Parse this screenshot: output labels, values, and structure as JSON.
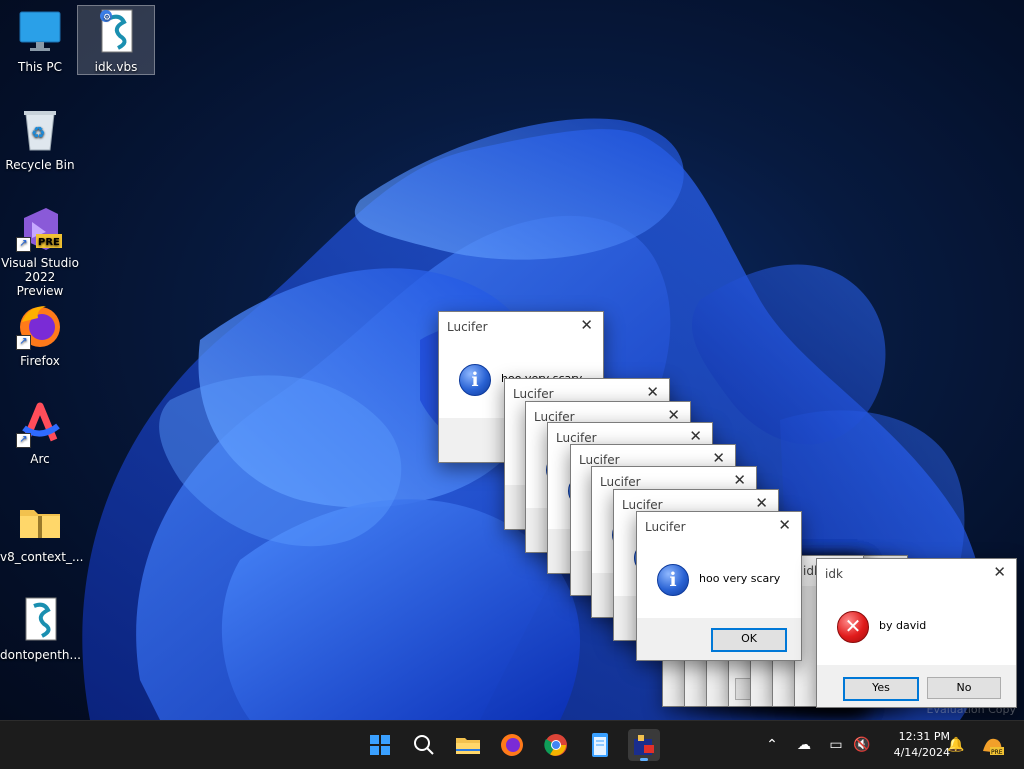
{
  "desktop_icons": [
    {
      "label": "This PC",
      "icon": "monitor-icon"
    },
    {
      "label": "idk.vbs",
      "icon": "script-file-icon"
    },
    {
      "label": "Recycle Bin",
      "icon": "recycle-bin-icon"
    },
    {
      "label": "Visual Studio 2022 Preview",
      "icon": "visual-studio-icon",
      "badge": "PRE"
    },
    {
      "label": "Firefox",
      "icon": "firefox-icon"
    },
    {
      "label": "Arc",
      "icon": "arc-icon"
    },
    {
      "label": "v8_context_...",
      "icon": "zip-folder-icon"
    },
    {
      "label": "dontopenth...",
      "icon": "script-file-icon"
    }
  ],
  "dialogs": {
    "lucifer_title": "Lucifer",
    "lucifer_message": "hoo very scary",
    "lucifer_ok": "OK",
    "idk_title": "idk",
    "idk_message": "by david",
    "idk_yes": "Yes",
    "idk_no": "No",
    "close_glyph": "✕"
  },
  "watermark": "Evaluation Copy",
  "taskbar": {
    "apps": [
      "start-icon",
      "search-icon",
      "file-explorer-icon",
      "firefox-icon",
      "chrome-icon",
      "notepad-icon",
      "script-host-icon"
    ],
    "time": "12:31 PM",
    "date": "4/14/2024"
  },
  "colors": {
    "accent": "#0078d7",
    "wallpaper": "#071a3f",
    "taskbar": "#1c1c1c"
  }
}
